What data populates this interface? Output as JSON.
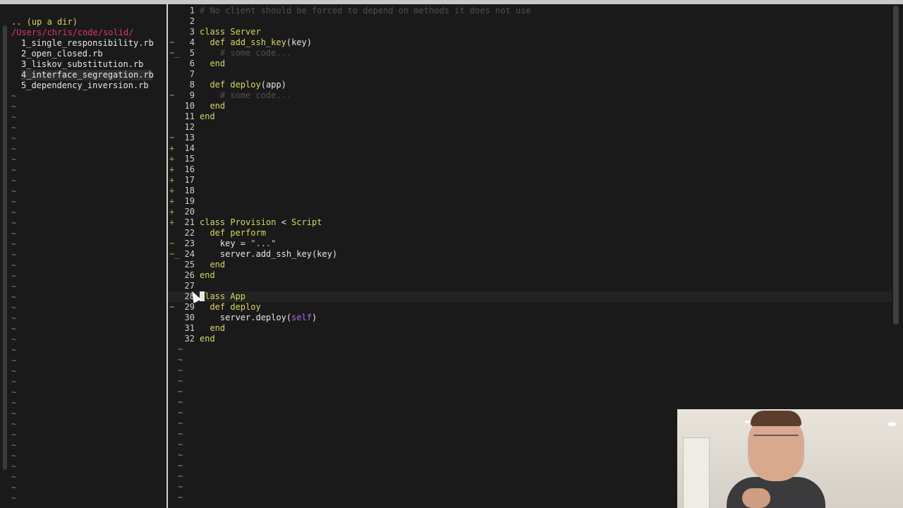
{
  "tree": {
    "updir": ".. (up a dir)",
    "path": "/Users/chris/code/solid/",
    "files": [
      "1_single_responsibility.rb",
      "2_open_closed.rb",
      "3_liskov_substitution.rb",
      "4_interface_segregation.rb",
      "5_dependency_inversion.rb"
    ],
    "selected_index": 3,
    "tilde": "~"
  },
  "editor": {
    "lines": [
      {
        "n": "1",
        "sign": "",
        "tokens": [
          [
            "comment",
            "# No client should be forced to depend on methods it does not use"
          ]
        ]
      },
      {
        "n": "2",
        "sign": "",
        "tokens": []
      },
      {
        "n": "3",
        "sign": "",
        "tokens": [
          [
            "kw",
            "class "
          ],
          [
            "const",
            "Server"
          ]
        ]
      },
      {
        "n": "4",
        "sign": "~",
        "tokens": [
          [
            "kw",
            "  def "
          ],
          [
            "def",
            "add_ssh_key"
          ],
          [
            "plain",
            "(key)"
          ]
        ]
      },
      {
        "n": "5",
        "sign": "~_",
        "tokens": [
          [
            "comment",
            "    # some code..."
          ]
        ]
      },
      {
        "n": "6",
        "sign": "",
        "tokens": [
          [
            "kw",
            "  end"
          ]
        ]
      },
      {
        "n": "7",
        "sign": "",
        "tokens": []
      },
      {
        "n": "8",
        "sign": "",
        "tokens": [
          [
            "kw",
            "  def "
          ],
          [
            "def",
            "deploy"
          ],
          [
            "plain",
            "(app)"
          ]
        ]
      },
      {
        "n": "9",
        "sign": "~",
        "tokens": [
          [
            "comment",
            "    # some code..."
          ]
        ]
      },
      {
        "n": "10",
        "sign": "",
        "tokens": [
          [
            "kw",
            "  end"
          ]
        ]
      },
      {
        "n": "11",
        "sign": "",
        "tokens": [
          [
            "kw",
            "end"
          ]
        ]
      },
      {
        "n": "12",
        "sign": "",
        "tokens": []
      },
      {
        "n": "13",
        "sign": "~",
        "tokens": []
      },
      {
        "n": "14",
        "sign": "+",
        "tokens": []
      },
      {
        "n": "15",
        "sign": "+",
        "tokens": []
      },
      {
        "n": "16",
        "sign": "+",
        "tokens": []
      },
      {
        "n": "17",
        "sign": "+",
        "tokens": []
      },
      {
        "n": "18",
        "sign": "+",
        "tokens": []
      },
      {
        "n": "19",
        "sign": "+",
        "tokens": []
      },
      {
        "n": "20",
        "sign": "+",
        "tokens": []
      },
      {
        "n": "21",
        "sign": "+",
        "tokens": [
          [
            "kw",
            "class "
          ],
          [
            "const",
            "Provision"
          ],
          [
            "plain",
            " < "
          ],
          [
            "const",
            "Script"
          ]
        ]
      },
      {
        "n": "22",
        "sign": "",
        "tokens": [
          [
            "kw",
            "  def "
          ],
          [
            "def",
            "perform"
          ]
        ]
      },
      {
        "n": "23",
        "sign": "~",
        "tokens": [
          [
            "plain",
            "    key = "
          ],
          [
            "str",
            "\"...\""
          ]
        ]
      },
      {
        "n": "24",
        "sign": "~_",
        "tokens": [
          [
            "plain",
            "    server.add_ssh_key(key)"
          ]
        ]
      },
      {
        "n": "25",
        "sign": "",
        "tokens": [
          [
            "kw",
            "  end"
          ]
        ]
      },
      {
        "n": "26",
        "sign": "",
        "tokens": [
          [
            "kw",
            "end"
          ]
        ]
      },
      {
        "n": "27",
        "sign": "",
        "tokens": []
      },
      {
        "n": "28",
        "sign": "",
        "tokens": [
          [
            "kw",
            "class "
          ],
          [
            "const",
            "App"
          ]
        ],
        "current": true
      },
      {
        "n": "29",
        "sign": "~",
        "tokens": [
          [
            "kw",
            "  def "
          ],
          [
            "def",
            "deploy"
          ]
        ]
      },
      {
        "n": "30",
        "sign": "",
        "tokens": [
          [
            "plain",
            "    server.deploy("
          ],
          [
            "self",
            "self"
          ],
          [
            "plain",
            ")"
          ]
        ]
      },
      {
        "n": "31",
        "sign": "",
        "tokens": [
          [
            "kw",
            "  end"
          ]
        ]
      },
      {
        "n": "32",
        "sign": "",
        "tokens": [
          [
            "kw",
            "end"
          ]
        ]
      }
    ],
    "tilde": "~",
    "tilde_count": 15
  },
  "colors": {
    "background": "#1a1a1a",
    "keyword": "#d7d75f",
    "comment": "#4f4f4f",
    "self": "#b26bd6",
    "path": "#e0336f",
    "sign_add": "#88b04b",
    "sign_mod": "#b6a13d"
  }
}
